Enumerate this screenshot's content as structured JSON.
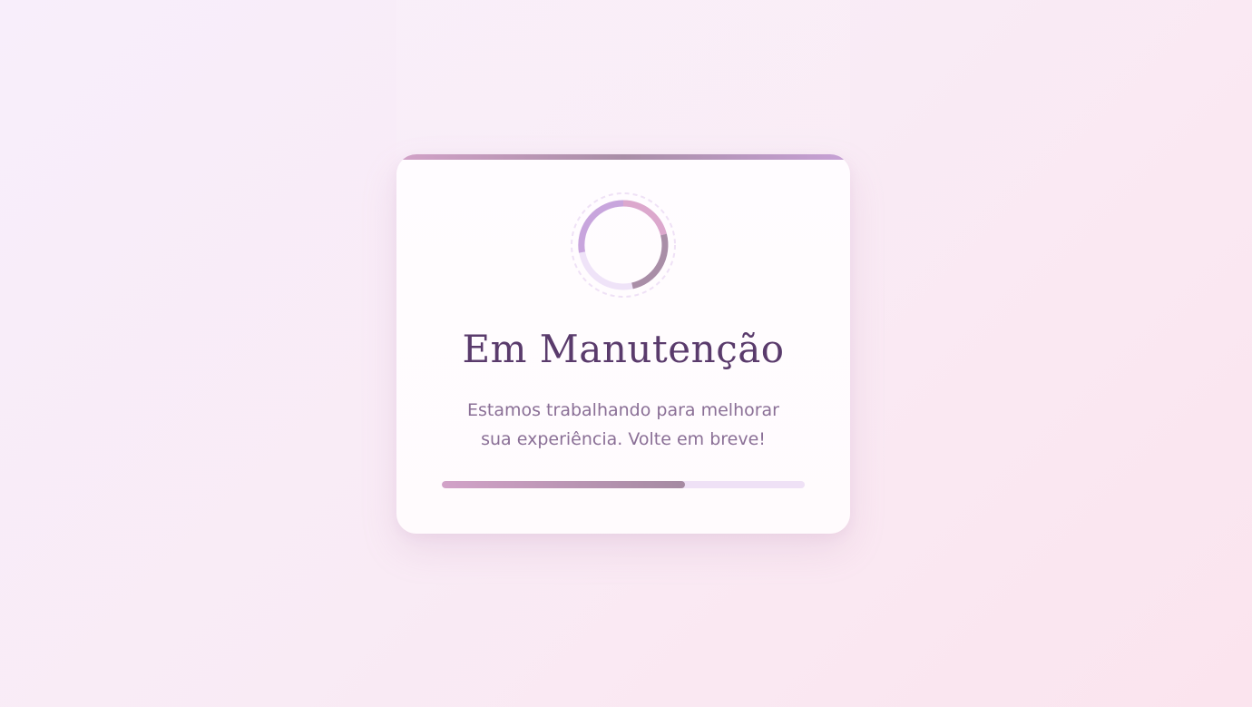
{
  "maintenance": {
    "title": "Em Manutenção",
    "message": "Estamos trabalhando para melhorar sua experiência. Volte em breve!",
    "progress": 0.67
  },
  "icons": {
    "spinner": "loading-spinner-icon"
  },
  "colors": {
    "background_start": "#f8eefb",
    "background_end": "#fbe4ee",
    "card": "#fffcff",
    "title": "#5a3b6c",
    "text": "#8a6f96",
    "accent_pink": "#d2a2c8",
    "accent_mauve": "#a58aa2",
    "accent_lilac": "#c7a1d6",
    "track": "#efe1f6"
  }
}
